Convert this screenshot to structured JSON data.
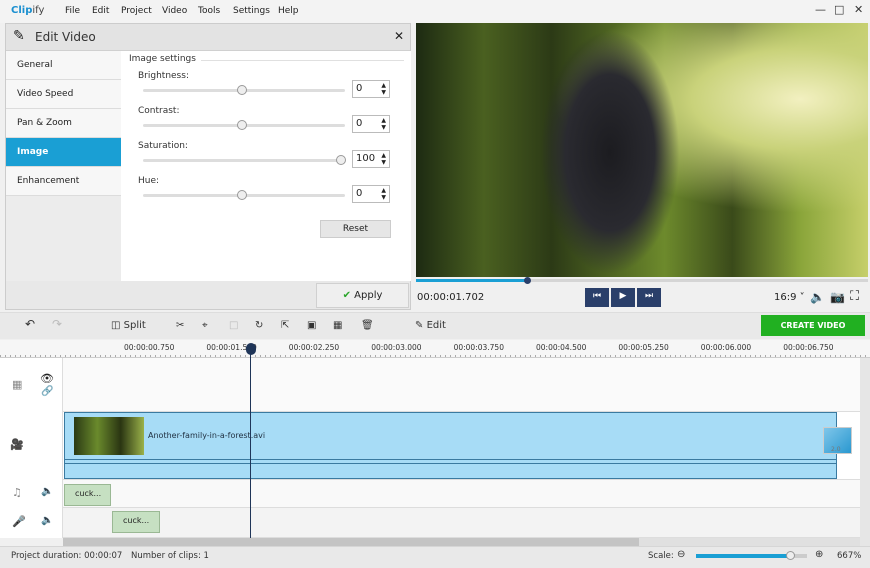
{
  "app": {
    "logo_a": "Clip",
    "logo_b": "ify"
  },
  "menu": [
    "File",
    "Edit",
    "Project",
    "Video",
    "Tools",
    "Settings",
    "Help"
  ],
  "panel": {
    "title": "Edit Video",
    "nav": [
      {
        "label": "General"
      },
      {
        "label": "Video Speed"
      },
      {
        "label": "Pan & Zoom"
      },
      {
        "label": "Image",
        "selected": true
      },
      {
        "label": "Enhancement"
      }
    ],
    "section": "Image settings",
    "settings": [
      {
        "label": "Brightness:",
        "value": "0",
        "fraction": 0.5
      },
      {
        "label": "Contrast:",
        "value": "0",
        "fraction": 0.5
      },
      {
        "label": "Saturation:",
        "value": "100",
        "fraction": 1.0
      },
      {
        "label": "Hue:",
        "value": "0",
        "fraction": 0.5
      }
    ],
    "reset": "Reset",
    "apply": "Apply"
  },
  "player": {
    "time": "00:00:01.702",
    "progress": 0.25,
    "aspect": "16:9"
  },
  "toolbar": {
    "split": "Split",
    "edit": "Edit",
    "create": "CREATE VIDEO"
  },
  "ruler": [
    "00:00:00.750",
    "00:00:01.500",
    "00:00:02.250",
    "00:00:03.000",
    "00:00:03.750",
    "00:00:04.500",
    "00:00:05.250",
    "00:00:06.000",
    "00:00:06.750"
  ],
  "timeline": {
    "video_clip": "Another-family-in-a-forest.avi",
    "transition": "2.0",
    "music_clip": "cuck...",
    "voice_clip": "cuck..."
  },
  "status": {
    "duration_label": "Project duration:",
    "duration": "00:00:07",
    "clips": "Number of clips: 1",
    "scale_label": "Scale:",
    "scale": "667%",
    "scale_fraction": 0.85
  },
  "colors": {
    "accent": "#1a9fd4",
    "create": "#21b021",
    "clip": "#a7dcf6"
  }
}
